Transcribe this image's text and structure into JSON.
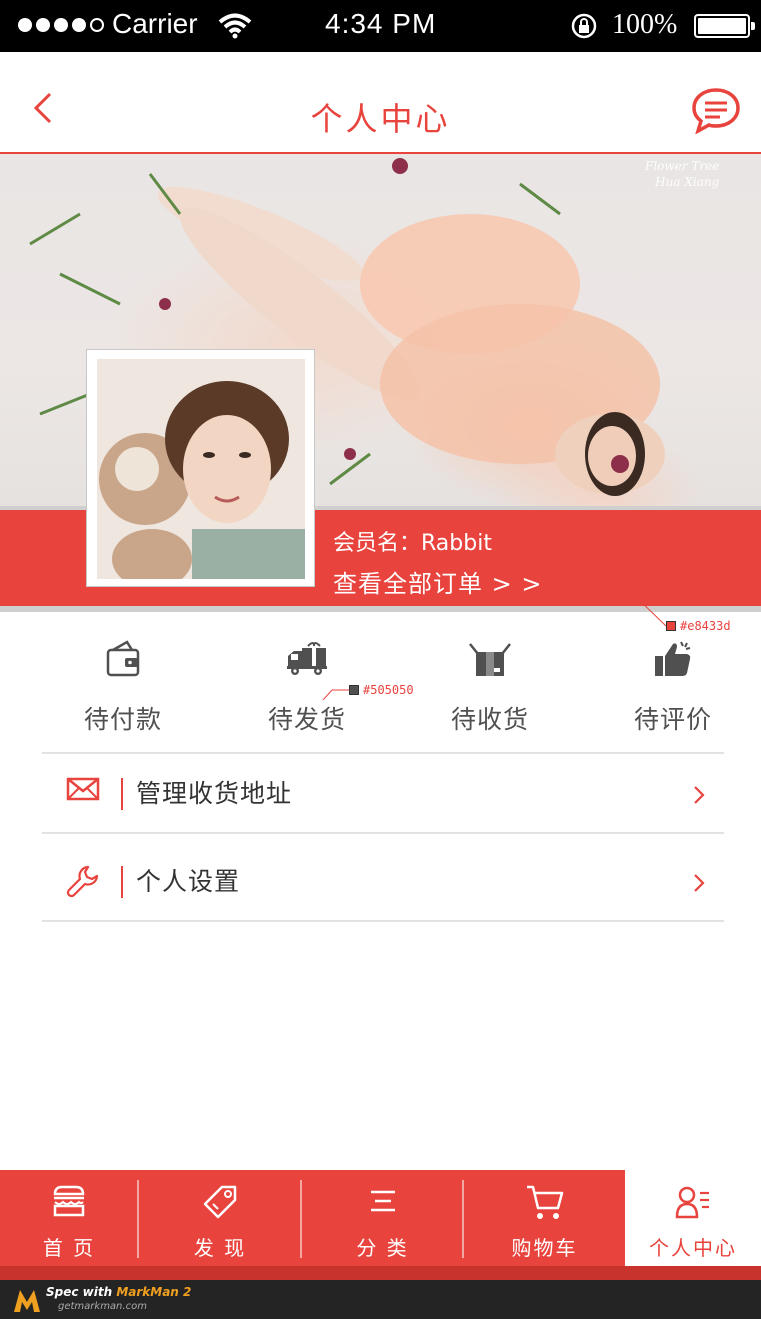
{
  "status_bar": {
    "carrier": "Carrier",
    "time": "4:34 PM",
    "battery": "100%"
  },
  "nav": {
    "title": "个人中心"
  },
  "banner": {
    "watermark_line1": "Flower Tree",
    "watermark_line2": "Hua Xiang"
  },
  "member": {
    "name_label": "会员名：Rabbit",
    "orders_link": "查看全部订单 > >"
  },
  "spec_annotations": {
    "strip_color": "#e8433d",
    "icon_color": "#505050"
  },
  "order_status": [
    {
      "label": "待付款",
      "icon": "wallet-icon"
    },
    {
      "label": "待发货",
      "icon": "delivery-truck-icon"
    },
    {
      "label": "待收货",
      "icon": "package-box-icon"
    },
    {
      "label": "待评价",
      "icon": "thumbs-up-icon"
    }
  ],
  "menu": [
    {
      "label": "管理收货地址",
      "icon": "envelope-icon"
    },
    {
      "label": "个人设置",
      "icon": "wrench-icon"
    }
  ],
  "tabs": [
    {
      "label": "首 页",
      "icon": "store-icon",
      "active": false
    },
    {
      "label": "发 现",
      "icon": "tag-icon",
      "active": false
    },
    {
      "label": "分 类",
      "icon": "list-icon",
      "active": false
    },
    {
      "label": "购物车",
      "icon": "cart-icon",
      "active": false
    },
    {
      "label": "个人中心",
      "icon": "user-profile-icon",
      "active": true
    }
  ],
  "footer": {
    "brand_prefix": "Spec with",
    "brand_name": "MarkMan 2",
    "url": "getmarkman.com"
  },
  "colors": {
    "accent": "#e8433d",
    "icon_gray": "#505050",
    "divider": "#e2e2e2"
  }
}
